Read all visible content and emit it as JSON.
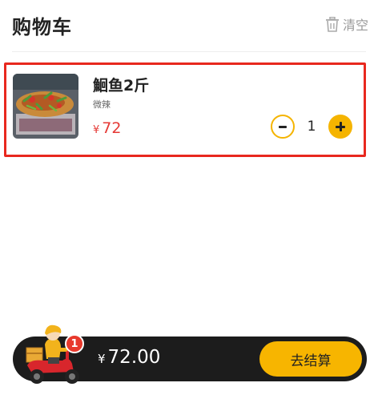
{
  "header": {
    "title": "购物车",
    "clear_label": "清空"
  },
  "cart": {
    "items": [
      {
        "name": "鮰鱼2斤",
        "spec": "微辣",
        "currency": "¥",
        "price": "72",
        "quantity": "1"
      }
    ]
  },
  "checkout": {
    "currency": "¥",
    "total": "72.00",
    "badge_count": "1",
    "button_label": "去结算"
  },
  "colors": {
    "accent": "#f7b500",
    "price": "#e53935",
    "highlight_border": "#e8281e",
    "bar": "#1c1c1c"
  }
}
